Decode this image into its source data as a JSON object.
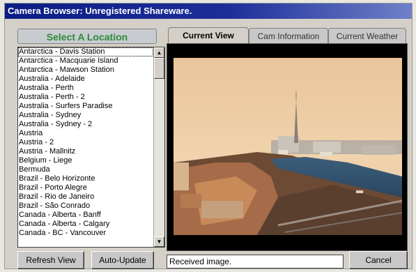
{
  "window": {
    "title": "Camera Browser: Unregistered Shareware."
  },
  "location_panel": {
    "header": "Select A Location",
    "items": [
      "Antarctica - Davis Station",
      "Antarctica - Macquarie Island",
      "Antarctica - Mawson Station",
      "Australia - Adelaide",
      "Australia - Perth",
      "Australia - Perth - 2",
      "Australia - Surfers Paradise",
      "Australia - Sydney",
      "Australia - Sydney - 2",
      "Austria",
      "Austria - 2",
      "Austria - Mallnitz",
      "Belgium - Liege",
      "Bermuda",
      "Brazil - Belo Horizonte",
      "Brazil - Porto Alegre",
      "Brazil - Rio de Janeiro",
      "Brazil - São Conrado",
      "Canada - Alberta - Banff",
      "Canada - Alberta - Calgary",
      "Canada - BC - Vancouver"
    ],
    "selected_index": 0
  },
  "tabs": [
    {
      "label": "Current View",
      "active": true
    },
    {
      "label": "Cam Information",
      "active": false
    },
    {
      "label": "Current Weather",
      "active": false
    }
  ],
  "buttons": {
    "refresh": "Refresh View",
    "auto_update": "Auto-Update",
    "cancel": "Cancel"
  },
  "status": {
    "text": "Received image."
  },
  "colors": {
    "title_bar": "#0a1e84",
    "location_header_text": "#2e8a3a",
    "window_face": "#d4d0c8"
  },
  "icons": {
    "scroll_up": "up-arrow-icon",
    "scroll_down": "down-arrow-icon"
  }
}
